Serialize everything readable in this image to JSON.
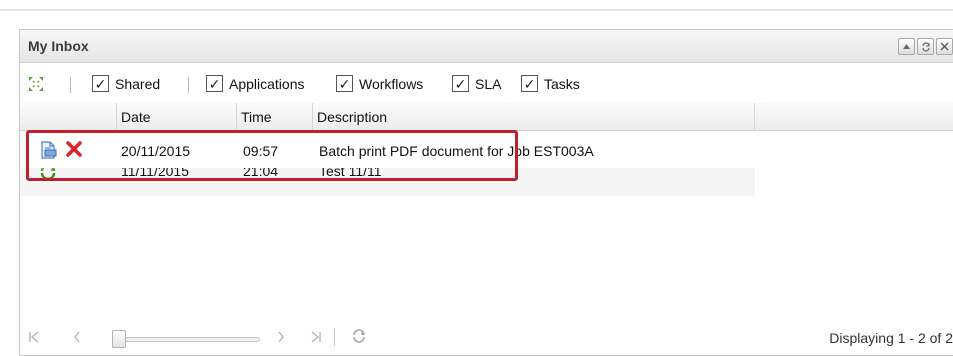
{
  "panel": {
    "title": "My Inbox"
  },
  "toolbar": {
    "filters": [
      {
        "label": "Shared",
        "checked": true
      },
      {
        "label": "Applications",
        "checked": true
      },
      {
        "label": "Workflows",
        "checked": true
      },
      {
        "label": "SLA",
        "checked": true
      },
      {
        "label": "Tasks",
        "checked": true
      }
    ],
    "check_glyph": "✓"
  },
  "grid": {
    "columns": [
      "Date",
      "Time",
      "Description"
    ],
    "rows": [
      {
        "date": "20/11/2015",
        "time": "09:57",
        "description": "Batch print PDF document for Job EST003A",
        "icons": [
          "print-document-icon",
          "delete-icon"
        ]
      },
      {
        "date": "11/11/2015",
        "time": "21:04",
        "description": "Test 11/11",
        "icons": [
          "refresh-task-icon"
        ]
      }
    ]
  },
  "pager": {
    "info": "Displaying 1 - 2 of 2"
  },
  "colors": {
    "highlight": "#c0202a",
    "delete": "#d92626",
    "icon_green": "#5aa33a",
    "icon_blue": "#4a7fc4"
  }
}
